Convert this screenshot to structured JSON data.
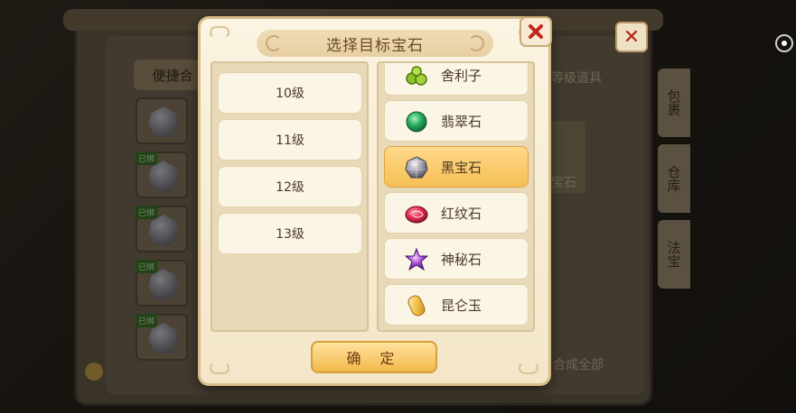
{
  "dialog": {
    "title": "选择目标宝石",
    "confirm_label": "确 定",
    "close_icon": "close-x-icon"
  },
  "levels": [
    {
      "label": "10级"
    },
    {
      "label": "11级"
    },
    {
      "label": "12级"
    },
    {
      "label": "13级"
    }
  ],
  "gems": [
    {
      "label": "舍利子",
      "icon": "sarira-icon",
      "selected": false
    },
    {
      "label": "翡翠石",
      "icon": "emerald-icon",
      "selected": false
    },
    {
      "label": "黑宝石",
      "icon": "black-gem-icon",
      "selected": true
    },
    {
      "label": "红纹石",
      "icon": "red-vein-stone-icon",
      "selected": false
    },
    {
      "label": "神秘石",
      "icon": "mystery-stone-icon",
      "selected": false
    },
    {
      "label": "昆仑玉",
      "icon": "kunlun-jade-icon",
      "selected": false
    }
  ],
  "background": {
    "shortcut_tab": "便捷合",
    "item_tag": "已绑",
    "side_tabs": [
      "包裹",
      "仓库",
      "法宝"
    ],
    "right_text_top": "等级道具",
    "right_text_mid": "宝石",
    "right_text_bottom": "合成全部"
  },
  "colors": {
    "selected_gem_bg": "#f6bf55",
    "dialog_bg": "#fbf4e2",
    "close_x": "#c0261c"
  }
}
